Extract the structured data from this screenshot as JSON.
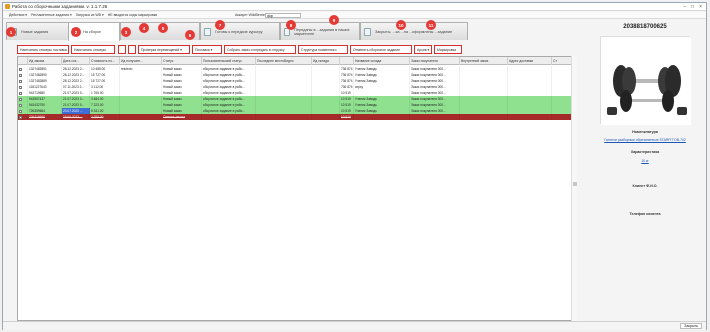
{
  "window": {
    "title": "Работа со сборочными заданиями. v. 1.1.7.26"
  },
  "menu": {
    "items": [
      "Действия ▾",
      "Регламентные задания ▾",
      "Загрузка из WB ▾",
      "НЕ вводятся коды маркировки"
    ],
    "account_label": "Аккаунт WildBerries:",
    "account_value": "фор"
  },
  "tabs": [
    {
      "label": "Новые задания"
    },
    {
      "label": "На сборке"
    },
    {
      "label": ""
    },
    {
      "label": "Готовы к передаче курьеру"
    },
    {
      "label": "Переданы в ...задания в наших маркетинге"
    },
    {
      "label": "Закрыты, ...ка ...на ...оформлены ...задание"
    }
  ],
  "toolbar": {
    "print_orders": "Напечатать стикеры поставок",
    "print_stickers": "Напечатать стикеры",
    "btn3": "",
    "btn4": "",
    "check_moves": "Проверка перемещений ▾",
    "delivery": "Поставка ▾",
    "collect": "Собрать заказ и передать в отгрузку",
    "structure": "Структура поименного",
    "cancel_order": "Отменить сборочное задание",
    "history": "Архив ▾",
    "marking": "Маркировка"
  },
  "badges": [
    "1",
    "2",
    "3",
    "4",
    "5",
    "6",
    "7",
    "8",
    "9",
    "10",
    "11"
  ],
  "grid": {
    "columns": [
      "",
      "Ид заказа",
      "Дата соз...",
      "Стоимость по...",
      "Ид получате...",
      "Статус",
      "Пользовательский статус",
      "Последнее местоВидно",
      "Ид склада",
      "",
      "Название склада",
      "Заказ покупателя",
      "Внутренний заказ",
      "Адрес доставки",
      "Ст"
    ],
    "rows": [
      {
        "style": "gray",
        "cells": [
          "",
          "1327482891",
          "28.12.2023 2...",
          "10 485.00",
          "reiuledo",
          "Новый заказ",
          "сборочное задание в рабо...",
          "",
          "",
          "736 874",
          "Ученик Заводь",
          "Заказ покупателя 000...",
          "",
          "",
          ""
        ]
      },
      {
        "style": "gray",
        "cells": [
          "",
          "1327482890",
          "28.12.2023 2...",
          "15 727.00",
          "",
          "Новый заказ",
          "сборочное задание в рабо...",
          "",
          "",
          "736 874",
          "Ученик Заводь",
          "Заказ покупателя 000...",
          "",
          "",
          ""
        ]
      },
      {
        "style": "gray",
        "cells": [
          "",
          "1327482889",
          "28.12.2023 2...",
          "15 727.00",
          "",
          "Новый заказ",
          "сборочное задание в рабо...",
          "",
          "",
          "736 874",
          "Ученик Заводь",
          "Заказ покупателя 000...",
          "",
          "",
          ""
        ]
      },
      {
        "style": "gray",
        "cells": [
          "",
          "1181227643",
          "07.11.2023 2...",
          "3 112.00",
          "",
          "Новый заказ",
          "сборочное задание в рабо...",
          "",
          "",
          "736 874",
          "атрху",
          "Заказ покупателя 000...",
          "",
          "",
          ""
        ]
      },
      {
        "style": "gray",
        "cells": [
          "",
          "943719680",
          "21.07.2023 0...",
          "1 765.00",
          "",
          "Новый заказ",
          "сборочное задание в рабо...",
          "",
          "",
          "10 519",
          "",
          "Заказ покупателя 000...",
          "",
          "",
          ""
        ]
      },
      {
        "style": "green",
        "cells": [
          "",
          "943557437",
          "21.07.2023 0...",
          "3 484.00",
          "",
          "Новый заказ",
          "сборочное задание в рабо...",
          "",
          "",
          "10 519",
          "Ученик Заводь",
          "Заказ покупателя 000...",
          "",
          "",
          ""
        ]
      },
      {
        "style": "green",
        "cells": [
          "",
          "943432790",
          "21.07.2023 0...",
          "7 223.00",
          "",
          "Новый заказ",
          "сборочное задание в рабо...",
          "",
          "",
          "10 519",
          "Ученик Заводь",
          "Заказ покупателя 000...",
          "",
          "",
          ""
        ]
      },
      {
        "style": "green sel",
        "cells": [
          "",
          "726359664",
          "20.07.2023 ...",
          "5 341.00",
          "",
          "Новый заказ",
          "сборочное задание в рабо...",
          "",
          "",
          "10 519",
          "Ученик Заводь",
          "Заказ покупателя 000...",
          "",
          "",
          ""
        ]
      },
      {
        "style": "red",
        "cells": [
          "",
          "726418666",
          "19.06.2023 ...",
          "2 765.00",
          "",
          "Отмена заказа",
          "",
          "",
          "",
          "10 519",
          "",
          "",
          "",
          "",
          ""
        ]
      }
    ]
  },
  "side": {
    "barcode": "2038818700625",
    "nomenclature_label": "Номенклатура",
    "nomenclature_link": "Гантели разборные обрезиненные STARFIT DB-702",
    "props_label": "Характеристика",
    "props_link": "10 кг",
    "client_label": "Клиент Ф.И.О.",
    "phone_label": "Телефон клиента"
  },
  "status": {
    "close": "Закрыть"
  },
  "colors": {
    "badge": "#e53935",
    "row_green": "#8fe08f",
    "row_red": "#a52a2a",
    "selection": "#3f6fd6"
  }
}
